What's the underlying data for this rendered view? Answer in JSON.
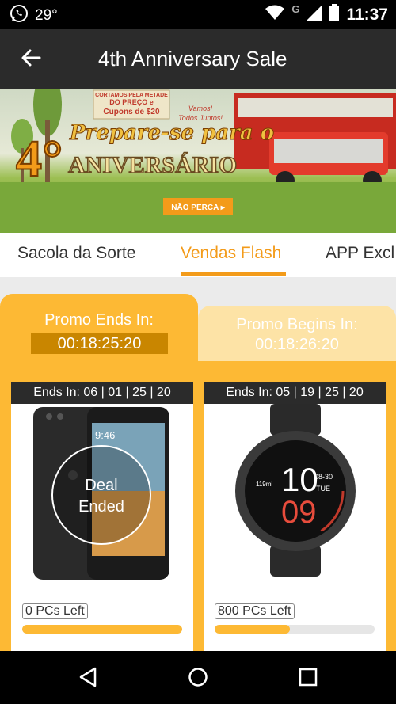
{
  "status_bar": {
    "temperature": "29°",
    "time": "11:37",
    "network": "G"
  },
  "app_bar": {
    "title": "4th Anniversary Sale"
  },
  "banner": {
    "headline_prefix": "4°",
    "script_text": "Prepare-se para o",
    "headline": "ANIVERSÁRIO",
    "sign_text_1": "CORTAMOS PELA METADE",
    "sign_text_2": "DO PREÇO e",
    "sign_text_3": "Cupons de $20",
    "bubble_text_1": "Vamos!",
    "bubble_text_2": "Todos Juntos!",
    "cta": "NÃO PERCA ▸"
  },
  "tabs": [
    {
      "label": "Sacola da Sorte",
      "active": false
    },
    {
      "label": "Vendas Flash",
      "active": true
    },
    {
      "label": "APP Excl",
      "active": false
    }
  ],
  "promo": {
    "active": {
      "label": "Promo Ends In:",
      "timer": "00:18:25:20"
    },
    "upcoming": {
      "label": "Promo Begins In:",
      "timer": "00:18:26:20"
    }
  },
  "products": [
    {
      "ends_in": "Ends In: 06 | 01 | 25 | 20",
      "overlay": "Deal\nEnded",
      "phone_time": "9:46",
      "pcs_left": "0 PCs Left",
      "progress": 1.0
    },
    {
      "ends_in": "Ends In: 05 | 19 | 25 | 20",
      "watch_hour": "10",
      "watch_minute": "09",
      "watch_date": "08-30",
      "watch_day": "TUE",
      "watch_miles": "119mi",
      "pcs_left": "800 PCs Left",
      "progress": 0.47
    }
  ],
  "colors": {
    "accent": "#f39b1a",
    "promo_yellow": "#fdb934",
    "timer_dark": "#c98600",
    "app_bar": "#2b2b2b"
  }
}
